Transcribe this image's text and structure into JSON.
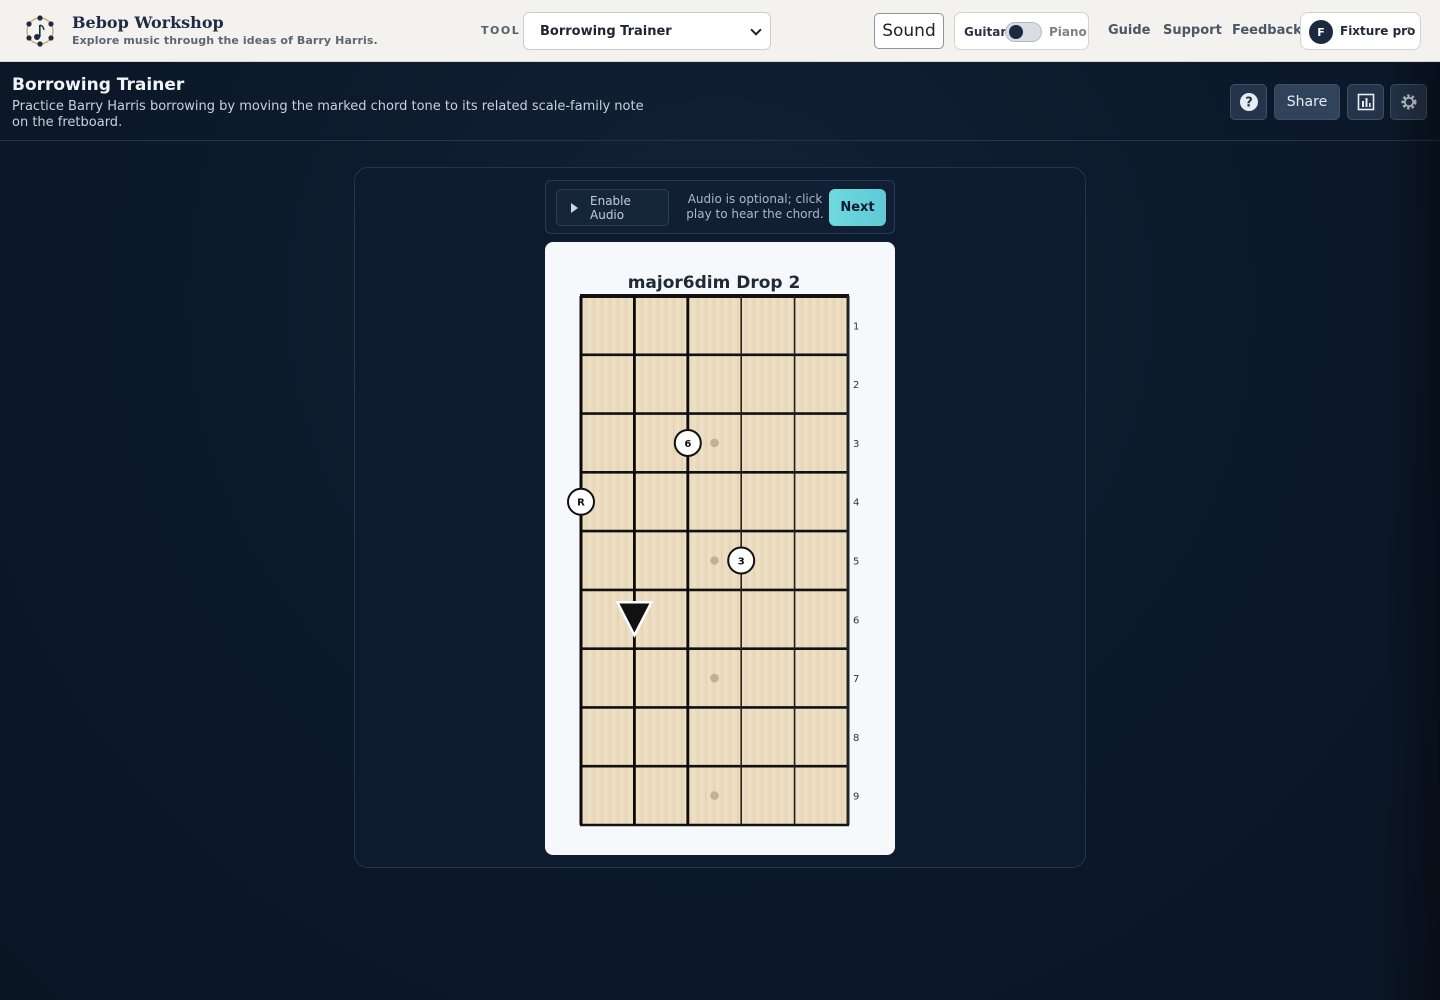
{
  "app": {
    "title": "Bebop Workshop",
    "subtitle": "Explore music through the ideas of Barry Harris."
  },
  "topbar": {
    "tool_label": "TOOL",
    "tool_selected": "Borrowing Trainer",
    "sound_label": "Sound",
    "instrument_left": "Guitar",
    "instrument_right": "Piano",
    "nav": [
      "Guide",
      "Support",
      "Feedback"
    ],
    "user_initial": "F",
    "user_name": "Fixture pro"
  },
  "page": {
    "title": "Borrowing Trainer",
    "description": "Practice Barry Harris borrowing by moving the marked chord tone to its related scale-family note on the fretboard.",
    "share_label": "Share"
  },
  "controls": {
    "enable_audio": "Enable Audio",
    "audio_note": "Audio is optional; click play to hear the chord.",
    "next_label": "Next"
  },
  "diagram": {
    "title": "major6dim Drop 2",
    "strings": 6,
    "fret_numbers": [
      "1",
      "2",
      "3",
      "4",
      "5",
      "6",
      "7",
      "8",
      "9"
    ],
    "inlay_frets": [
      3,
      5,
      7,
      9
    ],
    "notes": [
      {
        "label": "R",
        "string": 1,
        "fret": 4
      },
      {
        "label": "6",
        "string": 3,
        "fret": 3
      },
      {
        "label": "3",
        "string": 4,
        "fret": 5
      }
    ],
    "marker": {
      "shape": "down-triangle",
      "string": 2,
      "fret": 6
    }
  }
}
